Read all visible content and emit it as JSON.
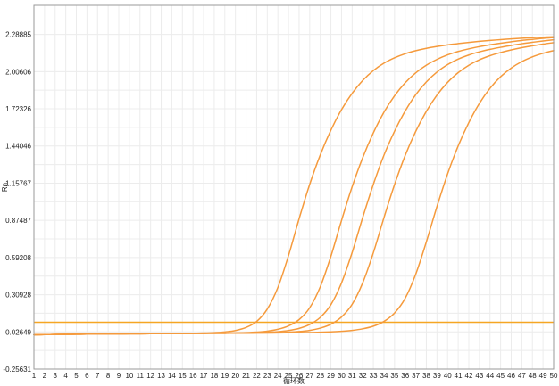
{
  "chart_data": {
    "type": "line",
    "title": "",
    "xlabel": "循环数",
    "ylabel": "Rn",
    "xlim": [
      1,
      50
    ],
    "ylim": [
      -0.25631,
      2.51
    ],
    "x": [
      1,
      2,
      3,
      4,
      5,
      6,
      7,
      8,
      9,
      10,
      11,
      12,
      13,
      14,
      15,
      16,
      17,
      18,
      19,
      20,
      21,
      22,
      23,
      24,
      25,
      26,
      27,
      28,
      29,
      30,
      31,
      32,
      33,
      34,
      35,
      36,
      37,
      38,
      39,
      40,
      41,
      42,
      43,
      44,
      45,
      46,
      47,
      48,
      49,
      50
    ],
    "x_ticks": [
      "1",
      "2",
      "3",
      "4",
      "5",
      "6",
      "7",
      "8",
      "9",
      "10",
      "11",
      "12",
      "13",
      "14",
      "15",
      "16",
      "17",
      "18",
      "19",
      "20",
      "21",
      "22",
      "23",
      "24",
      "25",
      "26",
      "27",
      "28",
      "29",
      "30",
      "31",
      "32",
      "33",
      "34",
      "35",
      "36",
      "37",
      "38",
      "39",
      "40",
      "41",
      "42",
      "43",
      "44",
      "45",
      "46",
      "47",
      "48",
      "49",
      "50"
    ],
    "y_ticks": [
      {
        "value": 2.28885,
        "label": "2.28885"
      },
      {
        "value": 2.00606,
        "label": "2.00606"
      },
      {
        "value": 1.72326,
        "label": "1.72326"
      },
      {
        "value": 1.44046,
        "label": "1.44046"
      },
      {
        "value": 1.15767,
        "label": "1.15767"
      },
      {
        "value": 0.87487,
        "label": "0.87487"
      },
      {
        "value": 0.59208,
        "label": "0.59208"
      },
      {
        "value": 0.30928,
        "label": "0.30928"
      },
      {
        "value": 0.02649,
        "label": "0.02649"
      },
      {
        "value": -0.25631,
        "label": "-0.25631"
      }
    ],
    "grid": true,
    "legend": "none",
    "threshold": {
      "value": 0.1,
      "color": "#f5a623"
    },
    "series_color": "#f59a3c",
    "series": [
      {
        "values": [
          0.005,
          0.006,
          0.007,
          0.008,
          0.009,
          0.01,
          0.01,
          0.011,
          0.011,
          0.012,
          0.012,
          0.013,
          0.013,
          0.014,
          0.015,
          0.016,
          0.018,
          0.021,
          0.026,
          0.037,
          0.06,
          0.106,
          0.2,
          0.364,
          0.606,
          0.887,
          1.149,
          1.373,
          1.561,
          1.717,
          1.841,
          1.939,
          2.014,
          2.07,
          2.111,
          2.142,
          2.165,
          2.183,
          2.197,
          2.209,
          2.219,
          2.228,
          2.236,
          2.243,
          2.249,
          2.255,
          2.26,
          2.264,
          2.268,
          2.271
        ]
      },
      {
        "values": [
          0.005,
          0.006,
          0.007,
          0.008,
          0.009,
          0.01,
          0.01,
          0.011,
          0.011,
          0.012,
          0.012,
          0.013,
          0.013,
          0.014,
          0.014,
          0.015,
          0.015,
          0.016,
          0.017,
          0.019,
          0.021,
          0.025,
          0.032,
          0.046,
          0.072,
          0.12,
          0.21,
          0.37,
          0.602,
          0.874,
          1.13,
          1.352,
          1.54,
          1.697,
          1.822,
          1.921,
          1.997,
          2.055,
          2.099,
          2.133,
          2.159,
          2.179,
          2.196,
          2.21,
          2.222,
          2.233,
          2.243,
          2.251,
          2.259,
          2.265
        ]
      },
      {
        "values": [
          0.005,
          0.006,
          0.007,
          0.008,
          0.009,
          0.01,
          0.01,
          0.011,
          0.011,
          0.012,
          0.012,
          0.013,
          0.013,
          0.014,
          0.014,
          0.015,
          0.015,
          0.016,
          0.016,
          0.017,
          0.018,
          0.02,
          0.023,
          0.028,
          0.037,
          0.053,
          0.083,
          0.137,
          0.234,
          0.399,
          0.63,
          0.897,
          1.148,
          1.37,
          1.553,
          1.706,
          1.831,
          1.928,
          2.003,
          2.059,
          2.101,
          2.132,
          2.156,
          2.175,
          2.191,
          2.205,
          2.218,
          2.229,
          2.239,
          2.248
        ]
      },
      {
        "values": [
          0.005,
          0.006,
          0.007,
          0.008,
          0.009,
          0.01,
          0.01,
          0.011,
          0.011,
          0.012,
          0.012,
          0.013,
          0.013,
          0.014,
          0.014,
          0.015,
          0.015,
          0.016,
          0.016,
          0.017,
          0.017,
          0.018,
          0.019,
          0.021,
          0.024,
          0.029,
          0.038,
          0.055,
          0.085,
          0.14,
          0.236,
          0.4,
          0.628,
          0.895,
          1.147,
          1.368,
          1.552,
          1.704,
          1.827,
          1.924,
          1.998,
          2.054,
          2.096,
          2.127,
          2.151,
          2.171,
          2.188,
          2.202,
          2.215,
          2.226
        ]
      },
      {
        "values": [
          0.005,
          0.006,
          0.007,
          0.008,
          0.009,
          0.01,
          0.01,
          0.011,
          0.011,
          0.012,
          0.012,
          0.013,
          0.013,
          0.014,
          0.014,
          0.015,
          0.015,
          0.016,
          0.016,
          0.017,
          0.017,
          0.018,
          0.018,
          0.019,
          0.02,
          0.021,
          0.022,
          0.024,
          0.027,
          0.031,
          0.038,
          0.05,
          0.07,
          0.106,
          0.17,
          0.282,
          0.466,
          0.712,
          0.98,
          1.228,
          1.441,
          1.618,
          1.764,
          1.879,
          1.967,
          2.033,
          2.082,
          2.118,
          2.145,
          2.166
        ]
      }
    ]
  }
}
